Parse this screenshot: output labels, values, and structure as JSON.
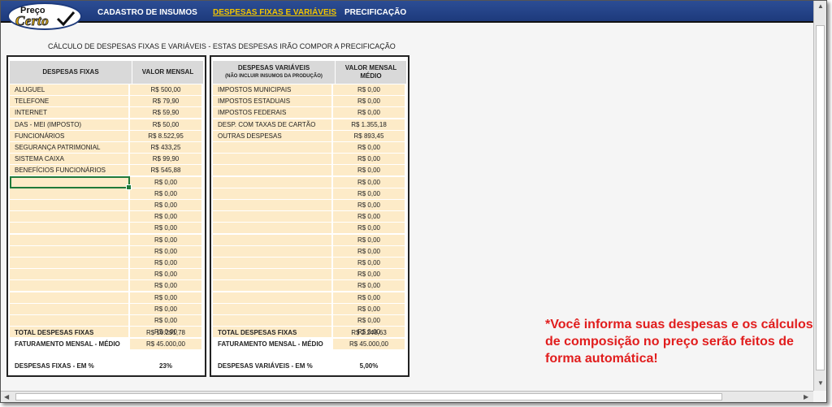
{
  "app": {
    "logo_top": "Preço",
    "logo_bottom": "Certo"
  },
  "nav": [
    {
      "label": "CADASTRO DE INSUMOS",
      "active": false
    },
    {
      "label": "DESPESAS FIXAS E VARIÁVEIS",
      "active": true
    },
    {
      "label": "PRECIFICAÇÃO",
      "active": false
    }
  ],
  "page_title": "CÁLCULO DE DESPESAS FIXAS E VARIÁVEIS - ESTAS DESPESAS IRÃO COMPOR A PRECIFICAÇÃO",
  "fixed": {
    "col_label": "DESPESAS FIXAS",
    "col_value": "VALOR MENSAL",
    "rows": [
      {
        "label": "ALUGUEL",
        "value": "R$ 500,00"
      },
      {
        "label": "TELEFONE",
        "value": "R$ 79,90"
      },
      {
        "label": "INTERNET",
        "value": "R$ 59,90"
      },
      {
        "label": "DAS - MEI (IMPOSTO)",
        "value": "R$ 50,00"
      },
      {
        "label": "FUNCIONÁRIOS",
        "value": "R$ 8.522,95"
      },
      {
        "label": "SEGURANÇA PATRIMONIAL",
        "value": "R$ 433,25"
      },
      {
        "label": "SISTEMA CAIXA",
        "value": "R$ 99,90"
      },
      {
        "label": "BENEFÍCIOS FUNCIONÁRIOS",
        "value": "R$ 545,88"
      },
      {
        "label": "",
        "value": "R$ 0,00"
      },
      {
        "label": "",
        "value": "R$ 0,00"
      },
      {
        "label": "",
        "value": "R$ 0,00"
      },
      {
        "label": "",
        "value": "R$ 0,00"
      },
      {
        "label": "",
        "value": "R$ 0,00"
      },
      {
        "label": "",
        "value": "R$ 0,00"
      },
      {
        "label": "",
        "value": "R$ 0,00"
      },
      {
        "label": "",
        "value": "R$ 0,00"
      },
      {
        "label": "",
        "value": "R$ 0,00"
      },
      {
        "label": "",
        "value": "R$ 0,00"
      },
      {
        "label": "",
        "value": "R$ 0,00"
      },
      {
        "label": "",
        "value": "R$ 0,00"
      },
      {
        "label": "",
        "value": "R$ 0,00"
      },
      {
        "label": "",
        "value": "R$ 0,00"
      }
    ],
    "total_label": "TOTAL DESPESAS FIXAS",
    "total_value": "R$ 10.291,78",
    "revenue_label": "FATURAMENTO MENSAL - MÉDIO",
    "revenue_value": "R$ 45.000,00",
    "pct_label": "DESPESAS FIXAS - EM %",
    "pct_value": "23%"
  },
  "variable": {
    "col_label": "DESPESAS VARIÁVEIS",
    "col_label_note": "(NÃO INCLUIR INSUMOS DA PRODUÇÃO)",
    "col_value": "VALOR MENSAL MÉDIO",
    "rows": [
      {
        "label": "IMPOSTOS MUNICIPAIS",
        "value": "R$ 0,00"
      },
      {
        "label": "IMPOSTOS ESTADUAIS",
        "value": "R$ 0,00"
      },
      {
        "label": "IMPOSTOS FEDERAIS",
        "value": "R$ 0,00"
      },
      {
        "label": "DESP. COM TAXAS DE CARTÃO",
        "value": "R$ 1.355,18"
      },
      {
        "label": "OUTRAS DESPESAS",
        "value": "R$ 893,45"
      },
      {
        "label": "",
        "value": "R$ 0,00"
      },
      {
        "label": "",
        "value": "R$ 0,00"
      },
      {
        "label": "",
        "value": "R$ 0,00"
      },
      {
        "label": "",
        "value": "R$ 0,00"
      },
      {
        "label": "",
        "value": "R$ 0,00"
      },
      {
        "label": "",
        "value": "R$ 0,00"
      },
      {
        "label": "",
        "value": "R$ 0,00"
      },
      {
        "label": "",
        "value": "R$ 0,00"
      },
      {
        "label": "",
        "value": "R$ 0,00"
      },
      {
        "label": "",
        "value": "R$ 0,00"
      },
      {
        "label": "",
        "value": "R$ 0,00"
      },
      {
        "label": "",
        "value": "R$ 0,00"
      },
      {
        "label": "",
        "value": "R$ 0,00"
      },
      {
        "label": "",
        "value": "R$ 0,00"
      },
      {
        "label": "",
        "value": "R$ 0,00"
      },
      {
        "label": "",
        "value": "R$ 0,00"
      },
      {
        "label": "",
        "value": "R$ 0,00"
      }
    ],
    "total_label": "TOTAL DESPESAS FIXAS",
    "total_value": "R$ 2.248,63",
    "revenue_label": "FATURAMENTO MENSAL - MÉDIO",
    "revenue_value": "R$ 45.000,00",
    "pct_label": "DESPESAS VARIÁVEIS - EM %",
    "pct_value": "5,00%"
  },
  "note": "*Você informa suas despesas e os cálculos de composição no preço serão feitos de forma automática!",
  "colors": {
    "topbar": "#1d3a7c",
    "active_nav": "#f2c500",
    "cell_fill": "#fdebc8",
    "header_fill": "#d9d9d9",
    "note": "#e11d1d",
    "selection": "#1f7a3a"
  },
  "icons": {
    "check": "check-icon",
    "scroll_up": "scroll-up-arrow-icon",
    "scroll_down": "scroll-down-arrow-icon",
    "scroll_left": "scroll-left-arrow-icon",
    "scroll_right": "scroll-right-arrow-icon"
  }
}
